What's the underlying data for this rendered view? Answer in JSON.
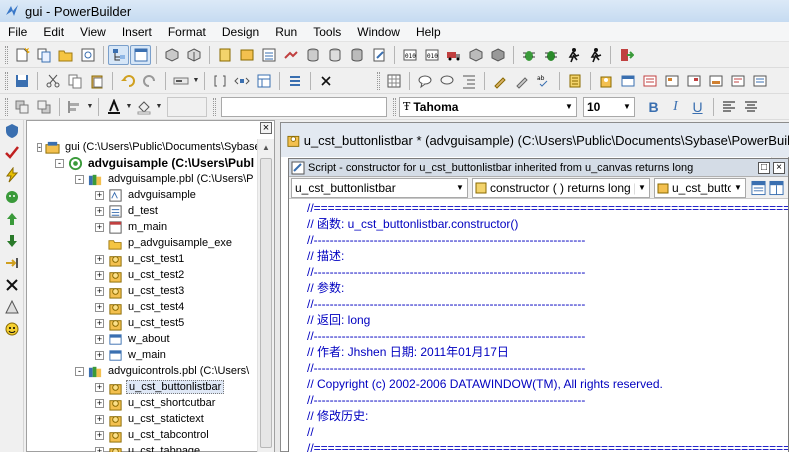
{
  "window": {
    "title": "gui - PowerBuilder"
  },
  "menu": {
    "items": [
      "File",
      "Edit",
      "View",
      "Insert",
      "Format",
      "Design",
      "Run",
      "Tools",
      "Window",
      "Help"
    ]
  },
  "font_toolbar": {
    "style_value": "",
    "font_name": "Tahoma",
    "font_size": "10",
    "bold_label": "B",
    "italic_label": "I",
    "underline_label": "U"
  },
  "tree": {
    "nodes": [
      {
        "label": "gui (C:\\Users\\Public\\Documents\\Sybase",
        "icon": "workspace-icon",
        "bold": false,
        "expander": "-"
      },
      {
        "label": "advguisample (C:\\Users\\Publ",
        "icon": "target-icon",
        "bold": true,
        "expander": "-"
      },
      {
        "label": "advguisample.pbl (C:\\Users\\P",
        "icon": "library-icon",
        "bold": false,
        "expander": "-"
      },
      {
        "label": "advguisample",
        "icon": "application-icon",
        "bold": false,
        "expander": "+"
      },
      {
        "label": "d_test",
        "icon": "datawindow-icon",
        "bold": false,
        "expander": "+"
      },
      {
        "label": "m_main",
        "icon": "menu-object-icon",
        "bold": false,
        "expander": "+"
      },
      {
        "label": "p_advguisample_exe",
        "icon": "project-icon",
        "bold": false,
        "expander": ""
      },
      {
        "label": "u_cst_test1",
        "icon": "user-object-icon",
        "bold": false,
        "expander": "+"
      },
      {
        "label": "u_cst_test2",
        "icon": "user-object-icon",
        "bold": false,
        "expander": "+"
      },
      {
        "label": "u_cst_test3",
        "icon": "user-object-icon",
        "bold": false,
        "expander": "+"
      },
      {
        "label": "u_cst_test4",
        "icon": "user-object-icon",
        "bold": false,
        "expander": "+"
      },
      {
        "label": "u_cst_test5",
        "icon": "user-object-icon",
        "bold": false,
        "expander": "+"
      },
      {
        "label": "w_about",
        "icon": "window-object-icon",
        "bold": false,
        "expander": "+"
      },
      {
        "label": "w_main",
        "icon": "window-object-icon",
        "bold": false,
        "expander": "+"
      },
      {
        "label": "advguicontrols.pbl (C:\\Users\\",
        "icon": "library-icon",
        "bold": false,
        "expander": "-"
      },
      {
        "label": "u_cst_buttonlistbar",
        "icon": "user-object-icon",
        "bold": false,
        "expander": "+",
        "selected": true
      },
      {
        "label": "u_cst_shortcutbar",
        "icon": "user-object-icon",
        "bold": false,
        "expander": "+"
      },
      {
        "label": "u_cst_statictext",
        "icon": "user-object-icon",
        "bold": false,
        "expander": "+"
      },
      {
        "label": "u_cst_tabcontrol",
        "icon": "user-object-icon",
        "bold": false,
        "expander": "+"
      },
      {
        "label": "u_cst_tabpage",
        "icon": "user-object-icon",
        "bold": false,
        "expander": "+"
      }
    ]
  },
  "editor": {
    "title": "u_cst_buttonlistbar * (advguisample) (C:\\Users\\Public\\Documents\\Sybase\\PowerBuil"
  },
  "script": {
    "title": "Script - constructor for u_cst_buttonlistbar inherited from u_canvas returns long",
    "object_select": "u_cst_buttonlistbar",
    "event_select": "constructor ( ) returns long [p",
    "ancestor_select": "u_cst_butto",
    "lines": [
      "//====================================================================",
      "// 函数: u_cst_buttonlistbar.constructor()",
      "//--------------------------------------------------------------------",
      "// 描述:",
      "//--------------------------------------------------------------------",
      "// 参数:",
      "//--------------------------------------------------------------------",
      "// 返回:  long",
      "//--------------------------------------------------------------------",
      "// 作者:  Jhshen        日期: 2011年01月17日",
      "//--------------------------------------------------------------------",
      "//  Copyright (c) 2002-2006 DATAWINDOW(TM), All rights reserved.",
      "//--------------------------------------------------------------------",
      "// 修改历史:",
      "//",
      "//===================================================================="
    ]
  },
  "colors": {
    "code_text": "#0000c0",
    "title_bar": "#c6dbf1",
    "selection": "#dfe8f6"
  }
}
